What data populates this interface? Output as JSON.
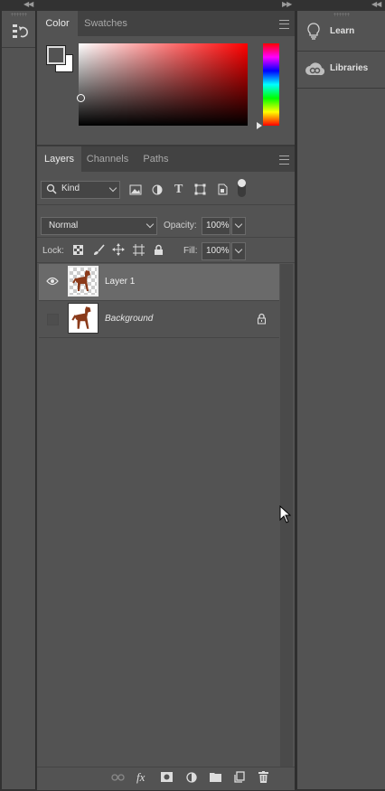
{
  "color_panel": {
    "tabs": [
      {
        "label": "Color",
        "active": true
      },
      {
        "label": "Swatches",
        "active": false
      }
    ],
    "foreground": "#535353",
    "background_color": "#ffffff",
    "hue_color": "#ff0000"
  },
  "layers_panel": {
    "tabs": [
      {
        "label": "Layers",
        "active": true
      },
      {
        "label": "Channels",
        "active": false
      },
      {
        "label": "Paths",
        "active": false
      }
    ],
    "filter_kind": "Kind",
    "blend_mode": "Normal",
    "opacity_label": "Opacity:",
    "opacity_value": "100%",
    "lock_label": "Lock:",
    "fill_label": "Fill:",
    "fill_value": "100%",
    "layers": [
      {
        "name": "Layer 1",
        "visible": true,
        "selected": true,
        "locked": false
      },
      {
        "name": "Background",
        "visible": false,
        "selected": false,
        "locked": true
      }
    ]
  },
  "right_panel": {
    "items": [
      {
        "label": "Learn",
        "icon": "lightbulb-icon"
      },
      {
        "label": "Libraries",
        "icon": "creative-cloud-libraries-icon"
      }
    ]
  }
}
